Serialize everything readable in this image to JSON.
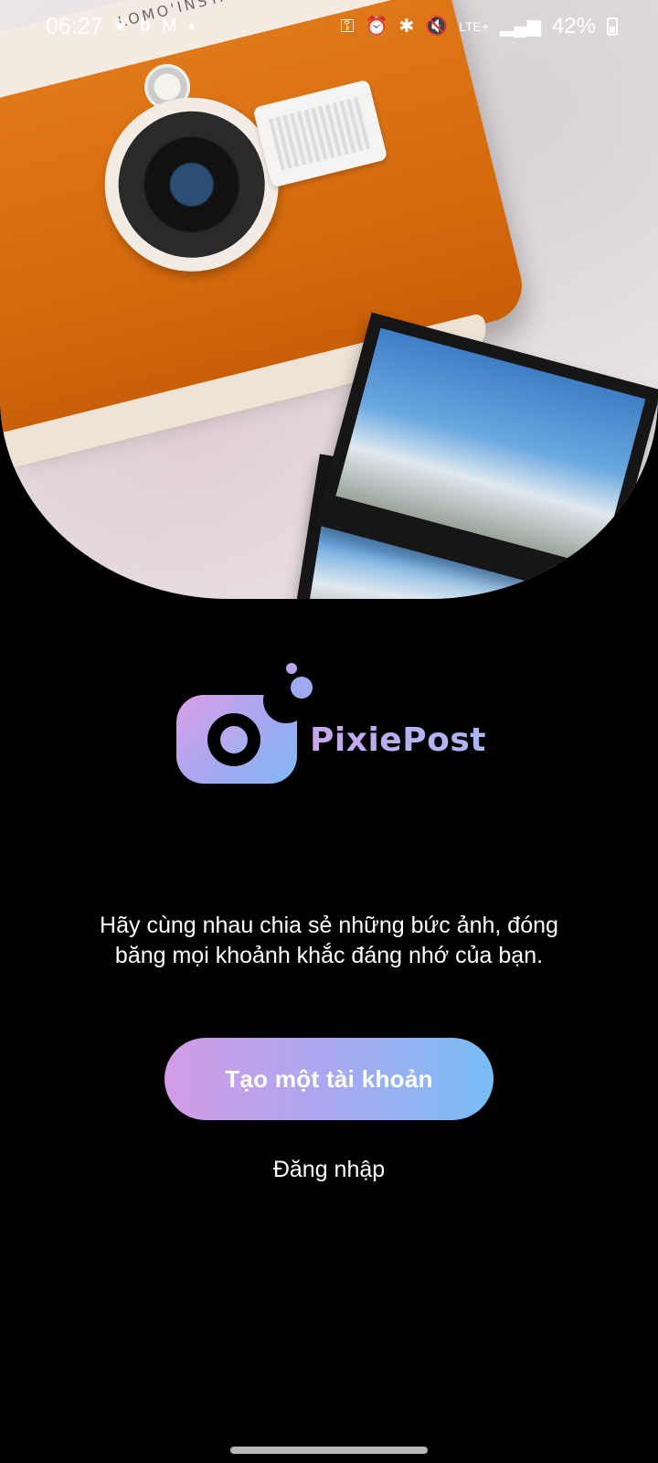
{
  "status_bar": {
    "time": "06:27",
    "left_icons": [
      "leaf-icon",
      "bing-icon",
      "gmail-icon",
      "dot-icon"
    ],
    "right_icons": [
      "key-icon",
      "alarm-icon",
      "bluetooth-icon",
      "mute-icon",
      "lte-icon",
      "signal-icon"
    ],
    "lte_label": "LTE+",
    "battery_percent": "42%"
  },
  "hero": {
    "camera_brand": "LOMO'INSTANT"
  },
  "brand": {
    "name": "PixiePost"
  },
  "tagline": "Hãy cùng nhau chia sẻ những bức ảnh, đóng băng mọi khoảnh khắc đáng nhớ của bạn.",
  "actions": {
    "create_account": "Tạo một tài khoản",
    "login": "Đăng nhập"
  },
  "colors": {
    "gradient_start": "#d49ce6",
    "gradient_end": "#79bdf6",
    "background": "#000000"
  }
}
